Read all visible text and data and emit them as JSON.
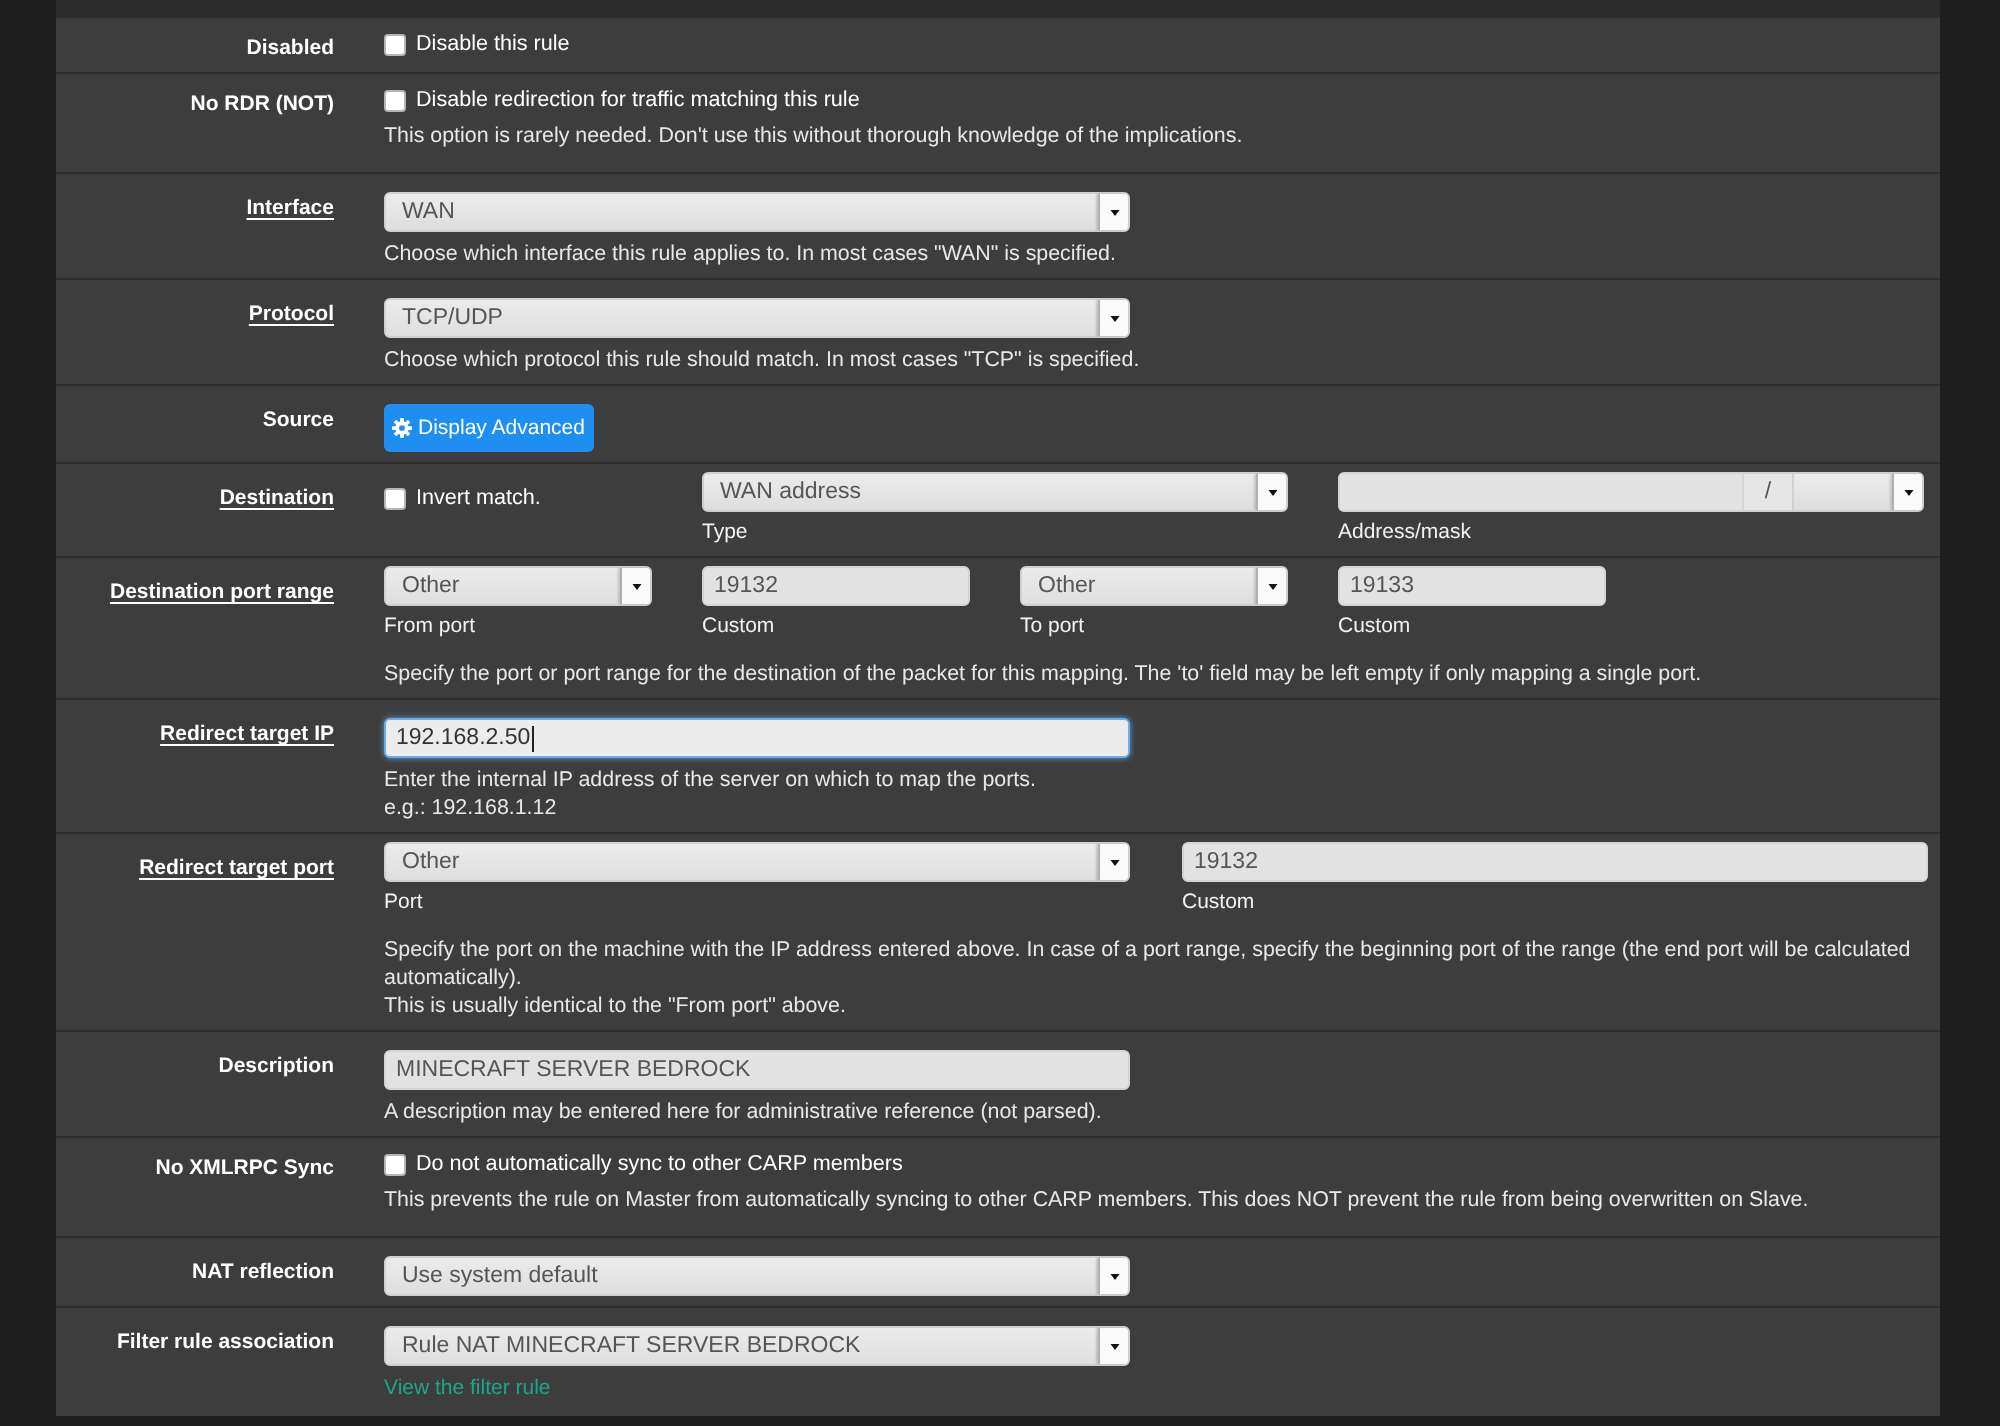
{
  "rows": [
    {
      "kind": "checkbox",
      "label": "Disabled",
      "linked": false,
      "checkbox": {
        "text": "Disable this rule",
        "checked": false
      }
    },
    {
      "kind": "checkbox",
      "label": "No RDR (NOT)",
      "linked": false,
      "checkbox": {
        "text": "Disable redirection for traffic matching this rule",
        "checked": false
      },
      "help": [
        "This option is rarely needed. Don't use this without thorough knowledge of the implications."
      ]
    },
    {
      "kind": "select",
      "label": "Interface",
      "linked": true,
      "select": {
        "value": "WAN"
      },
      "help": [
        "Choose which interface this rule applies to. In most cases \"WAN\" is specified."
      ]
    },
    {
      "kind": "select",
      "label": "Protocol",
      "linked": true,
      "select": {
        "value": "TCP/UDP"
      },
      "help": [
        "Choose which protocol this rule should match. In most cases \"TCP\" is specified."
      ]
    },
    {
      "kind": "button",
      "label": "Source",
      "linked": false,
      "button": {
        "text": "Display Advanced"
      }
    },
    {
      "kind": "destination",
      "label": "Destination",
      "linked": true,
      "checkbox": {
        "text": "Invert match.",
        "checked": false
      },
      "type": {
        "value": "WAN address",
        "caption": "Type"
      },
      "address": {
        "separator": "/",
        "caption": "Address/mask"
      }
    },
    {
      "kind": "fields",
      "label": "Destination port range",
      "linked": true,
      "fields": [
        {
          "kind": "select",
          "value": "Other",
          "caption": "From port"
        },
        {
          "kind": "input",
          "value": "19132",
          "caption": "Custom"
        },
        {
          "kind": "select",
          "value": "Other",
          "caption": "To port"
        },
        {
          "kind": "input",
          "value": "19133",
          "caption": "Custom"
        }
      ],
      "help": [
        "Specify the port or port range for the destination of the packet for this mapping. The 'to' field may be left empty if only mapping a single port."
      ]
    },
    {
      "kind": "input",
      "label": "Redirect target IP",
      "linked": true,
      "input": {
        "value": "192.168.2.50",
        "focused": true
      },
      "help": [
        "Enter the internal IP address of the server on which to map the ports.",
        "e.g.: 192.168.1.12"
      ]
    },
    {
      "kind": "fields",
      "label": "Redirect target port",
      "linked": true,
      "fields": [
        {
          "kind": "select",
          "value": "Other",
          "caption": "Port"
        },
        {
          "kind": "input",
          "value": "19132",
          "caption": "Custom"
        }
      ],
      "help": [
        "Specify the port on the machine with the IP address entered above. In case of a port range, specify the beginning port of the range (the end port will be calculated automatically).",
        "This is usually identical to the \"From port\" above."
      ]
    },
    {
      "kind": "input",
      "label": "Description",
      "linked": false,
      "input": {
        "value": "MINECRAFT SERVER BEDROCK",
        "focused": false
      },
      "help": [
        "A description may be entered here for administrative reference (not parsed)."
      ]
    },
    {
      "kind": "checkbox",
      "label": "No XMLRPC Sync",
      "linked": false,
      "checkbox": {
        "text": "Do not automatically sync to other CARP members",
        "checked": false
      },
      "help": [
        "This prevents the rule on Master from automatically syncing to other CARP members. This does NOT prevent the rule from being overwritten on Slave."
      ]
    },
    {
      "kind": "select",
      "label": "NAT reflection",
      "linked": false,
      "select": {
        "value": "Use system default"
      }
    },
    {
      "kind": "select",
      "label": "Filter rule association",
      "linked": false,
      "select": {
        "value": "Rule NAT MINECRAFT SERVER BEDROCK"
      },
      "link": "View the filter rule"
    }
  ]
}
